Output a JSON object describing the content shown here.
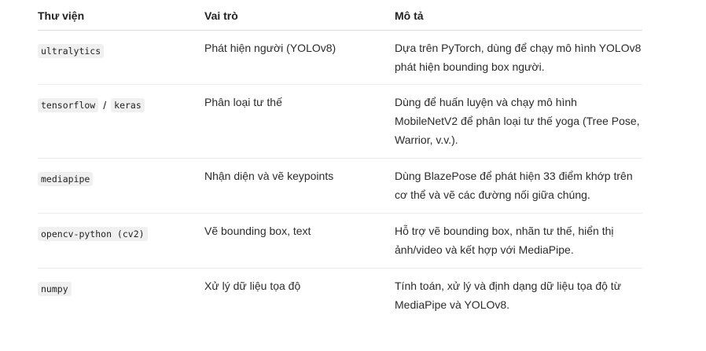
{
  "header": {
    "col1": "Thư viện",
    "col2": "Vai trò",
    "col3": "Mô tả"
  },
  "rows": [
    {
      "libs": [
        "ultralytics"
      ],
      "role": "Phát hiện người (YOLOv8)",
      "desc": [
        "Dựa trên PyTorch, dùng để chạy mô hình YOLOv8",
        "phát hiện bounding box người."
      ]
    },
    {
      "libs": [
        "tensorflow",
        "keras"
      ],
      "sep": "/",
      "role": "Phân loại tư thế",
      "desc": [
        "Dùng để huấn luyện và chạy mô hình",
        "MobileNetV2 để phân loại tư thế yoga (Tree Pose,",
        "Warrior, v.v.)."
      ]
    },
    {
      "libs": [
        "mediapipe"
      ],
      "role": "Nhận diện và vẽ keypoints",
      "desc": [
        "Dùng BlazePose để phát hiện 33 điểm khớp trên",
        "cơ thể và vẽ các đường nối giữa chúng."
      ]
    },
    {
      "libs": [
        "opencv-python (cv2)"
      ],
      "role": "Vẽ bounding box, text",
      "desc": [
        "Hỗ trợ vẽ bounding box, nhãn tư thế, hiển thị",
        "ảnh/video và kết hợp với MediaPipe."
      ]
    },
    {
      "libs": [
        "numpy"
      ],
      "role": "Xử lý dữ liệu tọa độ",
      "desc": [
        "Tính toán, xử lý và định dạng dữ liệu tọa độ từ",
        "MediaPipe và YOLOv8."
      ]
    }
  ]
}
